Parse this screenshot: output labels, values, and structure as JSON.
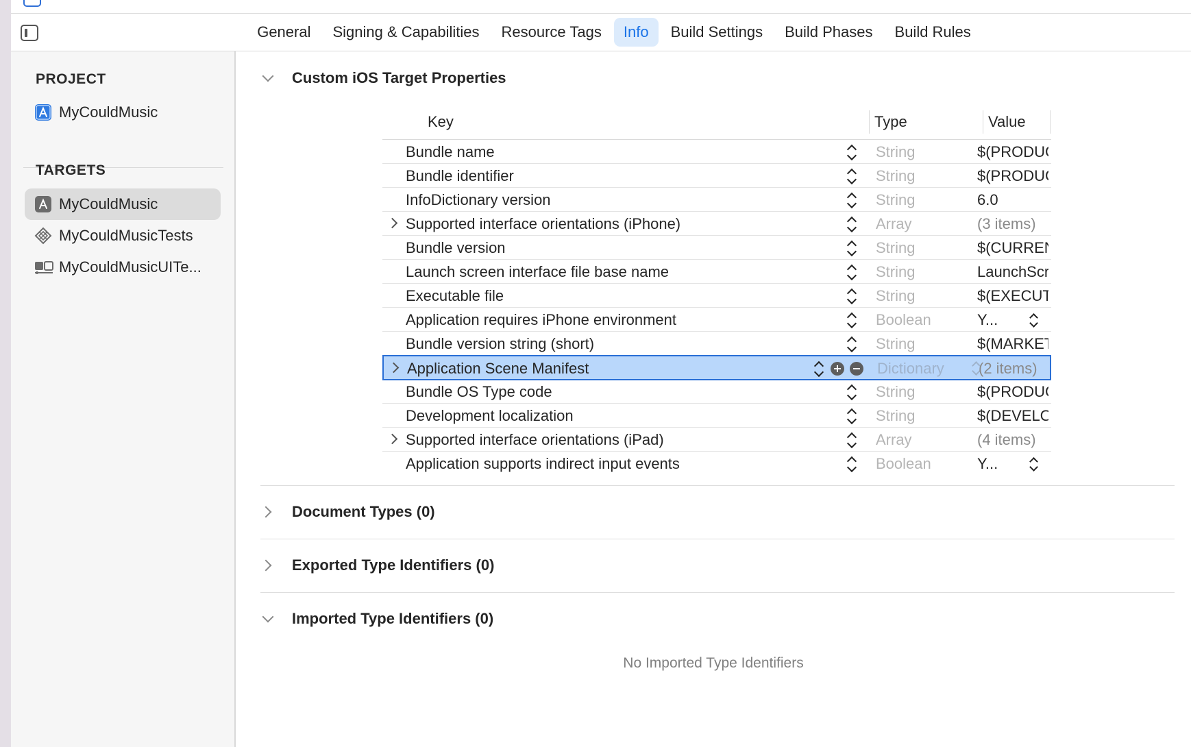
{
  "tabs": [
    {
      "label": "General"
    },
    {
      "label": "Signing & Capabilities"
    },
    {
      "label": "Resource Tags"
    },
    {
      "label": "Info",
      "active": true
    },
    {
      "label": "Build Settings"
    },
    {
      "label": "Build Phases"
    },
    {
      "label": "Build Rules"
    }
  ],
  "sidebar": {
    "project_heading": "PROJECT",
    "project_item": "MyCouldMusic",
    "targets_heading": "TARGETS",
    "targets": [
      {
        "label": "MyCouldMusic",
        "icon": "app-target-icon",
        "selected": true
      },
      {
        "label": "MyCouldMusicTests",
        "icon": "unit-test-icon"
      },
      {
        "label": "MyCouldMusicUITe...",
        "icon": "ui-test-icon"
      }
    ]
  },
  "custom_props": {
    "title": "Custom iOS Target Properties",
    "columns": {
      "key": "Key",
      "type": "Type",
      "value": "Value"
    },
    "rows": [
      {
        "key": "Bundle name",
        "type": "String",
        "value": "$(PRODUCT_NAME)"
      },
      {
        "key": "Bundle identifier",
        "type": "String",
        "value": "$(PRODUCT_BUNDLE_IDENTIFIER)"
      },
      {
        "key": "InfoDictionary version",
        "type": "String",
        "value": "6.0"
      },
      {
        "key": "Supported interface orientations (iPhone)",
        "type": "Array",
        "value": "(3 items)",
        "expandable": true
      },
      {
        "key": "Bundle version",
        "type": "String",
        "value": "$(CURRENT_PROJECT_VERSION)"
      },
      {
        "key": "Launch screen interface file base name",
        "type": "String",
        "value": "LaunchScreen"
      },
      {
        "key": "Executable file",
        "type": "String",
        "value": "$(EXECUTABLE_NAME)"
      },
      {
        "key": "Application requires iPhone environment",
        "type": "Boolean",
        "value": "Y...",
        "popup": true
      },
      {
        "key": "Bundle version string (short)",
        "type": "String",
        "value": "$(MARKETING_VERSION)"
      },
      {
        "key": "Application Scene Manifest",
        "type": "Dictionary",
        "value": "(2 items)",
        "expandable": true,
        "selected": true
      },
      {
        "key": "Bundle OS Type code",
        "type": "String",
        "value": "$(PRODUCT_BUNDLE_PACKAGE_TYPE)"
      },
      {
        "key": "Development localization",
        "type": "String",
        "value": "$(DEVELOPMENT_LANGUAGE_REGION)"
      },
      {
        "key": "Supported interface orientations (iPad)",
        "type": "Array",
        "value": "(4 items)",
        "expandable": true
      },
      {
        "key": "Application supports indirect input events",
        "type": "Boolean",
        "value": "Y...",
        "popup": true
      }
    ]
  },
  "groups": {
    "document_types": "Document Types (0)",
    "exported_types": "Exported Type Identifiers (0)",
    "imported_types": "Imported Type Identifiers (0)"
  },
  "empty_note": "No Imported Type Identifiers",
  "colors": {
    "accent": "#1a73e8",
    "selection": "#b9d7fb",
    "selection_border": "#2a6fd6"
  }
}
